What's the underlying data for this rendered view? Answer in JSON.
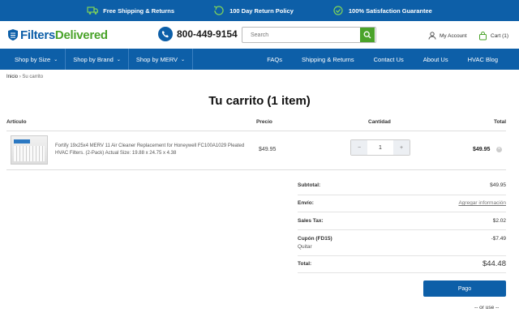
{
  "topbar": {
    "items": [
      {
        "icon": "truck-icon",
        "label": "Free Shipping & Returns"
      },
      {
        "icon": "return-icon",
        "label": "100 Day Return Policy"
      },
      {
        "icon": "guarantee-icon",
        "label": "100% Satisfaction Guarantee"
      }
    ]
  },
  "header": {
    "logo_part1": "Filters",
    "logo_part2": "Delivered",
    "phone": "800-449-9154",
    "search_placeholder": "Search",
    "account_label": "My Account",
    "cart_label": "Cart (1)"
  },
  "nav": {
    "left": [
      "Shop by Size",
      "Shop by Brand",
      "Shop by MERV"
    ],
    "right": [
      "FAQs",
      "Shipping & Returns",
      "Contact Us",
      "About Us",
      "HVAC Blog"
    ]
  },
  "breadcrumb": {
    "home": "Inicio",
    "current": "Su carrito"
  },
  "page_title": "Tu carrito (1 item)",
  "table": {
    "headers": {
      "item": "Artículo",
      "price": "Precio",
      "qty": "Cantidad",
      "total": "Total"
    },
    "row": {
      "name": "Fortify 19x25x4 MERV 11 Air Cleaner Replacement for Honeywell FC100A1029 Pleated HVAC Filters. (2-Pack) Actual Size: 19.88 x 24.75 x 4.38",
      "price": "$49.95",
      "quantity": "1",
      "total": "$49.95",
      "minus": "−",
      "plus": "+",
      "remove": "×"
    }
  },
  "summary": {
    "subtotal_label": "Subtotal:",
    "subtotal": "$49.95",
    "shipping_label": "Envío:",
    "shipping": "Agregar información",
    "tax_label": "Sales Tax:",
    "tax": "$2.02",
    "coupon_label": "Cupón (FD15)",
    "coupon": "-$7.49",
    "coupon_remove": "Quitar",
    "total_label": "Total:",
    "total": "$44.48"
  },
  "checkout": {
    "pay_label": "Pago",
    "or_use": "-- or use --"
  },
  "colors": {
    "primary": "#0d5fa8",
    "accent": "#4aa32a"
  }
}
